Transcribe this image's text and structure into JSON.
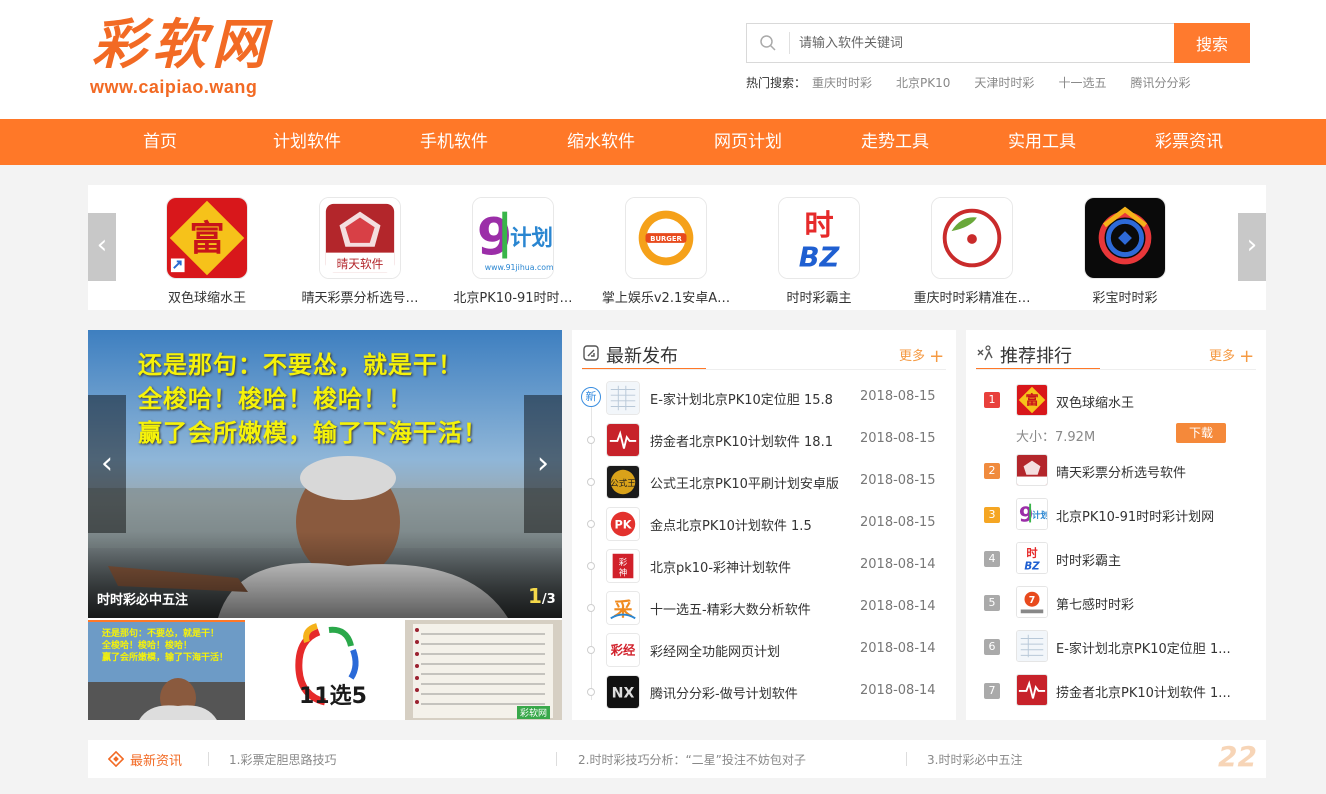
{
  "logo": {
    "cn": "彩软网",
    "url": "www.caipiao.wang"
  },
  "search": {
    "placeholder": "请输入软件关键词",
    "button": "搜索"
  },
  "hot": {
    "label": "热门搜索：",
    "items": [
      "重庆时时彩",
      "北京PK10",
      "天津时时彩",
      "十一选五",
      "腾讯分分彩"
    ]
  },
  "nav": [
    "首页",
    "计划软件",
    "手机软件",
    "缩水软件",
    "网页计划",
    "走势工具",
    "实用工具",
    "彩票资讯"
  ],
  "apps": [
    {
      "name": "双色球缩水王",
      "icon": "fu-icon"
    },
    {
      "name": "晴天彩票分析选号…",
      "icon": "qingtian-icon"
    },
    {
      "name": "北京PK10-91时时…",
      "icon": "91jihua-icon"
    },
    {
      "name": "掌上娱乐v2.1安卓A…",
      "icon": "burger-icon"
    },
    {
      "name": "时时彩霸主",
      "icon": "shi-bz-icon"
    },
    {
      "name": "重庆时时彩精准在…",
      "icon": "leaf-circle-icon"
    },
    {
      "name": "彩宝时时彩",
      "icon": "caibao-icon"
    }
  ],
  "banner": {
    "lines": [
      "还是那句：不要怂，就是干！",
      "全梭哈！梭哈！梭哈！！",
      "赢了会所嫩模，输了下海干活！"
    ],
    "caption": "时时彩必中五注",
    "page": "1",
    "total": "/3",
    "thumb1_lines": [
      "还是那句：不要怂，就是干！",
      "全梭哈！梭哈！梭哈！",
      "赢了会所嫩模，输了下海干活！"
    ],
    "thumb2_text": "11选5",
    "thumb3_badge": "彩软网"
  },
  "latest": {
    "title": "最新发布",
    "more": "更多",
    "new_badge": "新",
    "items": [
      {
        "title": "E-家计划北京PK10定位胆 15.8",
        "date": "2018-08-15",
        "icon": "spreadsheet-icon"
      },
      {
        "title": "捞金者北京PK10计划软件 18.1",
        "date": "2018-08-15",
        "icon": "pulse-icon"
      },
      {
        "title": "公式王北京PK10平刷计划安卓版",
        "date": "2018-08-15",
        "icon": "gongshi-icon"
      },
      {
        "title": "金点北京PK10计划软件 1.5",
        "date": "2018-08-15",
        "icon": "pk-icon"
      },
      {
        "title": "北京pk10-彩神计划软件",
        "date": "2018-08-14",
        "icon": "caishen-icon"
      },
      {
        "title": "十一选五-精彩大数分析软件",
        "date": "2018-08-14",
        "icon": "cai-icon"
      },
      {
        "title": "彩经网全功能网页计划",
        "date": "2018-08-14",
        "icon": "caijing-icon"
      },
      {
        "title": "腾讯分分彩-做号计划软件",
        "date": "2018-08-14",
        "icon": "nx-icon"
      }
    ]
  },
  "ranking": {
    "title": "推荐排行",
    "more": "更多",
    "first": {
      "name": "双色球缩水王",
      "size": "大小：7.92M",
      "download": "下载"
    },
    "items": [
      {
        "num": "2",
        "name": "晴天彩票分析选号软件"
      },
      {
        "num": "3",
        "name": "北京PK10-91时时彩计划网"
      },
      {
        "num": "4",
        "name": "时时彩霸主"
      },
      {
        "num": "5",
        "name": "第七感时时彩"
      },
      {
        "num": "6",
        "name": "E-家计划北京PK10定位胆 1..."
      },
      {
        "num": "7",
        "name": "捞金者北京PK10计划软件 1..."
      }
    ],
    "first_num": "1"
  },
  "news_ticker": {
    "label": "最新资讯",
    "items": [
      "1.彩票定胆思路技巧",
      "2.时时彩技巧分析：“二星”投注不妨包对子",
      "3.时时彩必中五注"
    ]
  },
  "watermark": "22",
  "colors": {
    "accent": "#ff7828",
    "rank1": "#e8403c",
    "rank2": "#f08b3e",
    "rank3": "#f5a623",
    "rank_other": "#aaaaaa"
  }
}
